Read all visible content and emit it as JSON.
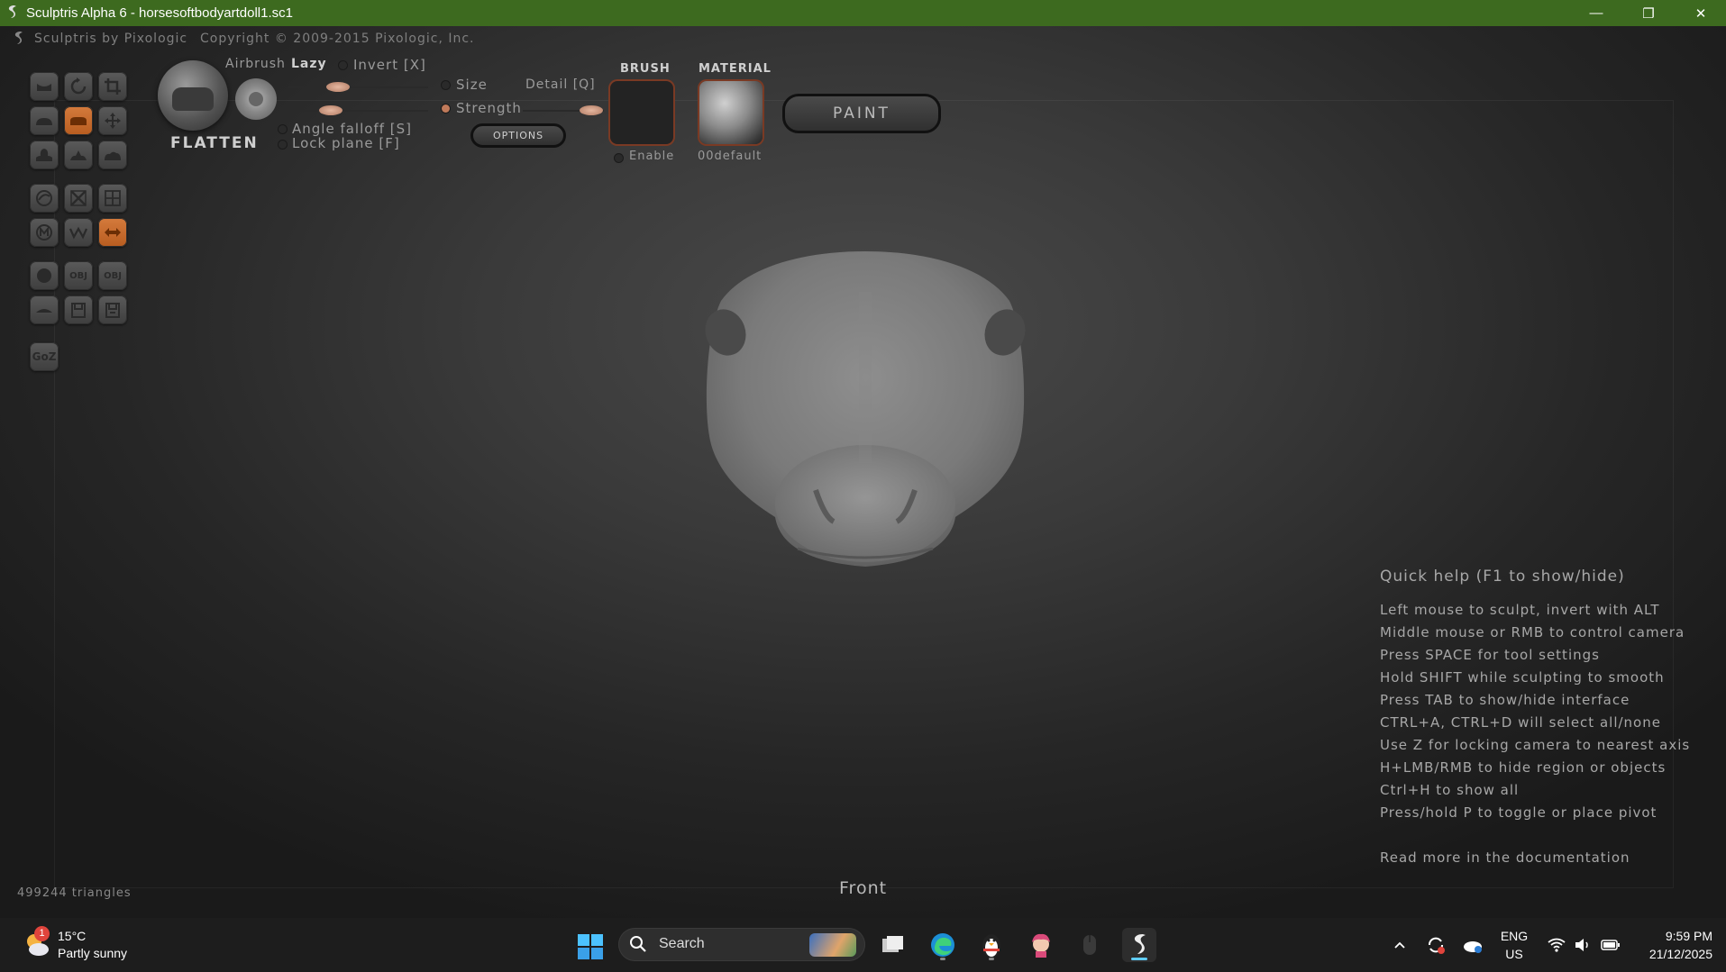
{
  "window": {
    "title": "Sculptris Alpha 6 - horsesoftbodyartdoll1.sc1",
    "minimize": "—",
    "restore": "❐",
    "close": "✕"
  },
  "app_header": {
    "brand": "Sculptris by Pixologic",
    "copyright": "Copyright © 2009-2015 Pixologic, Inc."
  },
  "toolbar": {
    "tool_name": "FLATTEN",
    "airbrush": "Airbrush",
    "lazy": "Lazy",
    "invert": "Invert [X]",
    "size": "Size",
    "detail": "Detail [Q]",
    "strength": "Strength",
    "angle_falloff": "Angle falloff [S]",
    "lock_plane": "Lock plane [F]",
    "options": "OPTIONS",
    "brush_label": "BRUSH",
    "brush_enable": "Enable",
    "material_label": "MATERIAL",
    "material_name": "00default",
    "paint": "PAINT"
  },
  "tools": {
    "goz": "GoZ",
    "obj1": "OBJ",
    "obj2": "OBJ"
  },
  "quick_help": {
    "title": "Quick help (F1 to show/hide)",
    "lines": [
      "Left mouse to sculpt, invert with ALT",
      "Middle mouse or RMB to control camera",
      "Press SPACE for tool settings",
      "Hold SHIFT while sculpting to smooth",
      "Press TAB to show/hide interface",
      "CTRL+A, CTRL+D will select all/none",
      "Use Z for locking camera to nearest axis",
      "H+LMB/RMB to hide region or objects",
      "Ctrl+H to show all",
      "Press/hold P to toggle or place pivot"
    ],
    "more": "Read more in the documentation"
  },
  "status": {
    "triangles": "499244 triangles",
    "view": "Front"
  },
  "taskbar": {
    "weather_badge": "1",
    "weather_temp": "15°C",
    "weather_desc": "Partly sunny",
    "search": "Search",
    "lang_top": "ENG",
    "lang_bottom": "US",
    "time": "9:59 PM",
    "date": "21/12/2025"
  },
  "colors": {
    "titlebar": "#3d6a1f",
    "active_tool": "#d47a3c",
    "slider_knob": "#e5b7a0"
  }
}
